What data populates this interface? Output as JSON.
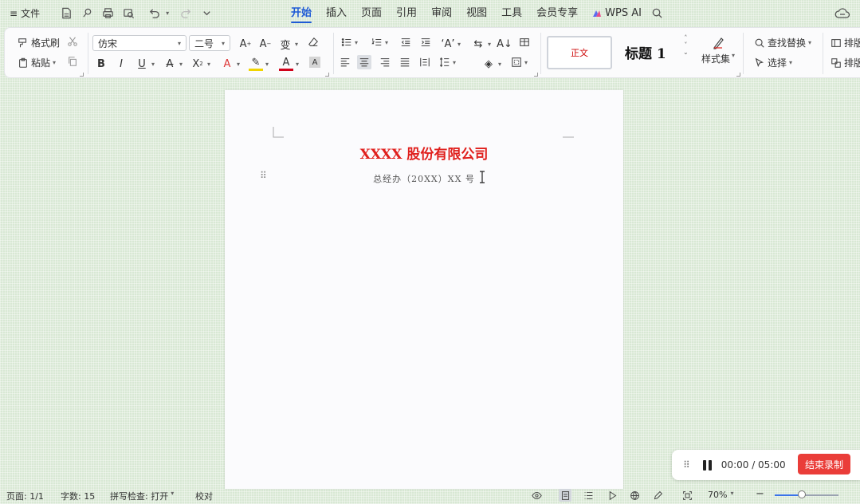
{
  "menubar": {
    "menu_icon": "≡",
    "file_label": "文件",
    "tabs": [
      {
        "label": "开始",
        "active": true
      },
      {
        "label": "插入"
      },
      {
        "label": "页面"
      },
      {
        "label": "引用"
      },
      {
        "label": "审阅"
      },
      {
        "label": "视图"
      },
      {
        "label": "工具"
      },
      {
        "label": "会员专享"
      },
      {
        "label": "WPS AI"
      }
    ]
  },
  "ribbon": {
    "format_painter": "格式刷",
    "paste": "粘贴",
    "font_name": "仿宋",
    "font_size": "二号",
    "style_normal": "正文",
    "style_heading": "标题 1",
    "style_set": "样式集",
    "find_replace": "查找替换",
    "select": "选择",
    "sort_label": "排版",
    "sort_label2": "排版"
  },
  "document": {
    "title": "XXXX 股份有限公司",
    "subtitle": "总经办（20XX）XX 号"
  },
  "recorder": {
    "time": "00:00 / 05:00",
    "stop_label": "结束录制"
  },
  "statusbar": {
    "page": "页面: 1/1",
    "words": "字数: 15",
    "spellcheck": "拼写检查: 打开",
    "proofread": "校对",
    "zoom": "70%"
  },
  "colors": {
    "accent": "#1f5bd6",
    "title_red": "#e0201d",
    "stop_button": "#ea3d39"
  }
}
